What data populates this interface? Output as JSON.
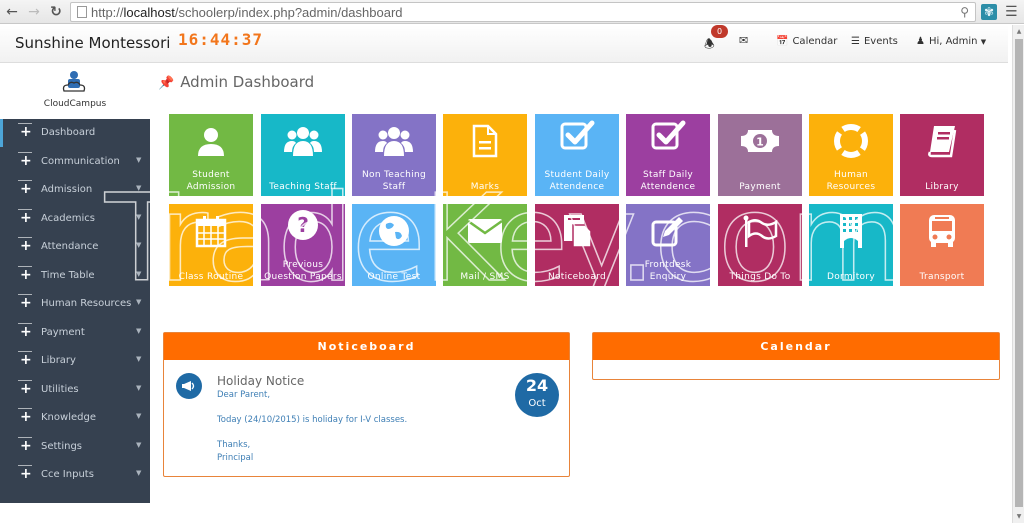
{
  "browser": {
    "url_prefix": "http://",
    "url_host": "localhost",
    "url_path": "/schoolerp/index.php?admin/dashboard"
  },
  "header": {
    "school_name": "Sunshine Montessori",
    "clock": "16:44:37",
    "notification_count": "0",
    "calendar_label": "Calendar",
    "events_label": "Events",
    "user_label": "Hi, Admin"
  },
  "logo": {
    "text": "CloudCampus"
  },
  "sidebar": {
    "items": [
      {
        "label": "Dashboard",
        "active": true,
        "has_submenu": false
      },
      {
        "label": "Communication",
        "has_submenu": true
      },
      {
        "label": "Admission",
        "has_submenu": true
      },
      {
        "label": "Academics",
        "has_submenu": true
      },
      {
        "label": "Attendance",
        "has_submenu": true
      },
      {
        "label": "Time Table",
        "has_submenu": true
      },
      {
        "label": "Human Resources",
        "has_submenu": true
      },
      {
        "label": "Payment",
        "has_submenu": true
      },
      {
        "label": "Library",
        "has_submenu": true
      },
      {
        "label": "Utilities",
        "has_submenu": true
      },
      {
        "label": "Knowledge",
        "has_submenu": true
      },
      {
        "label": "Settings",
        "has_submenu": true
      },
      {
        "label": "Cce Inputs",
        "has_submenu": true
      }
    ]
  },
  "main": {
    "page_title": "Admin Dashboard",
    "tiles": [
      {
        "label": "Student Admission",
        "icon": "user-icon",
        "color": "#72b944"
      },
      {
        "label": "Teaching Staff",
        "icon": "users-icon",
        "color": "#17b8c8"
      },
      {
        "label": "Non Teaching Staff",
        "icon": "users-icon",
        "color": "#8473c6"
      },
      {
        "label": "Marks",
        "icon": "document-icon",
        "color": "#fcb10b"
      },
      {
        "label": "Student Daily Attendence",
        "icon": "checkbox-icon",
        "color": "#5ab4f5"
      },
      {
        "label": "Staff Daily Attendence",
        "icon": "checkbox-icon",
        "color": "#9c3fa0"
      },
      {
        "label": "Payment",
        "icon": "money-icon",
        "color": "#9c7099"
      },
      {
        "label": "Human Resources",
        "icon": "lifebuoy-icon",
        "color": "#fcb10b"
      },
      {
        "label": "Library",
        "icon": "book-icon",
        "color": "#b02d62"
      },
      {
        "label": "Class Routine",
        "icon": "calendar-icon",
        "color": "#fcb10b"
      },
      {
        "label": "Previous Question Papers",
        "icon": "question-icon",
        "color": "#9c3fa0"
      },
      {
        "label": "Online Test",
        "icon": "globe-icon",
        "color": "#5ab4f5"
      },
      {
        "label": "Mail / SMS",
        "icon": "envelope-icon",
        "color": "#72b944"
      },
      {
        "label": "Noticeboard",
        "icon": "files-icon",
        "color": "#b02d62"
      },
      {
        "label": "Frontdesk Enquiry",
        "icon": "edit-icon",
        "color": "#8473c6"
      },
      {
        "label": "Things Do To",
        "icon": "flag-icon",
        "color": "#b02d62"
      },
      {
        "label": "Dormitory",
        "icon": "building-icon",
        "color": "#17b8c8"
      },
      {
        "label": "Transport",
        "icon": "bus-icon",
        "color": "#f07b54"
      }
    ]
  },
  "noticeboard": {
    "title": "Noticeboard",
    "notice": {
      "heading": "Holiday Notice",
      "lines": [
        "Dear Parent,",
        "Today (24/10/2015) is holiday for I-V classes.",
        "Thanks,",
        "Principal"
      ],
      "day": "24",
      "month": "Oct"
    }
  },
  "calendar_panel": {
    "title": "Calendar"
  },
  "watermark": {
    "text": "TradeKey.com"
  }
}
